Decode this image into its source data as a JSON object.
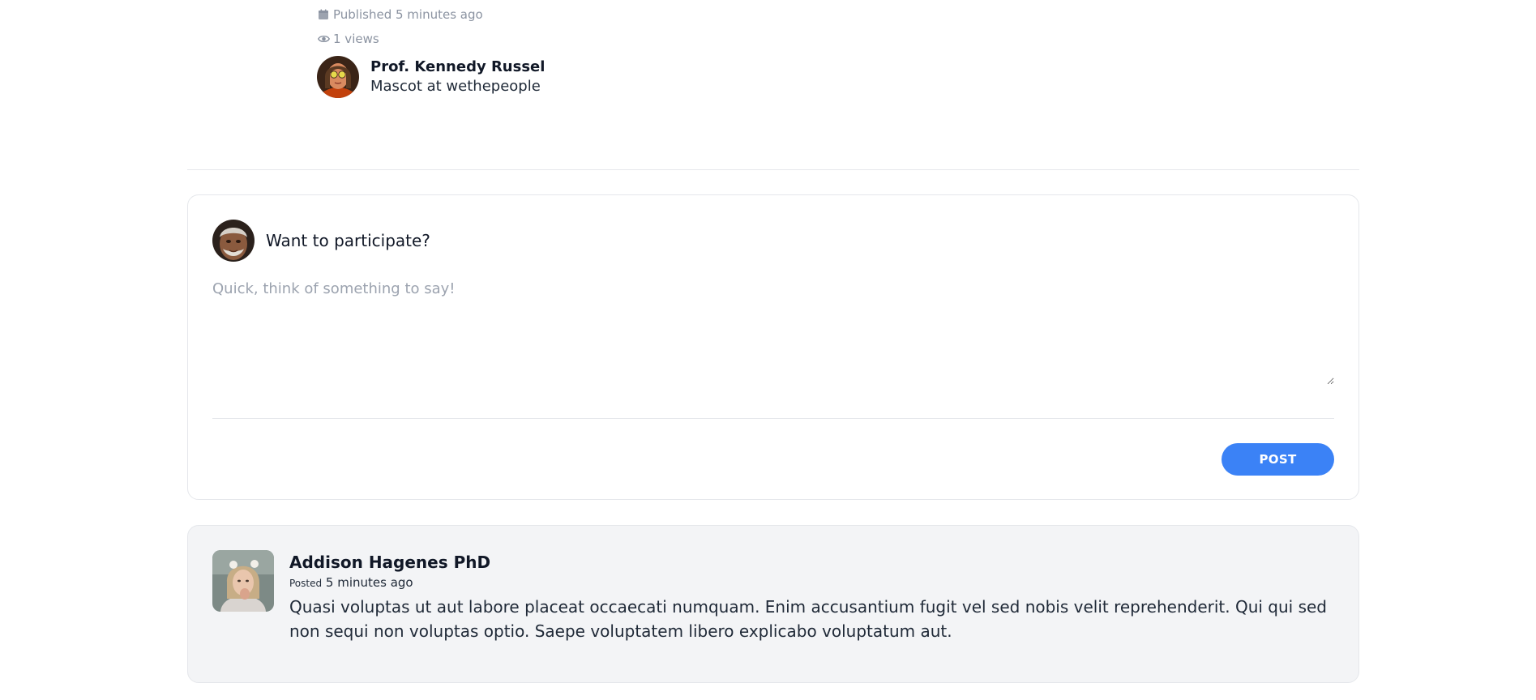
{
  "article_meta": {
    "published_text": "Published 5 minutes ago",
    "views_text": "1 views",
    "author": {
      "name": "Prof. Kennedy Russel",
      "role": "Mascot at wethepeople"
    }
  },
  "comment_form": {
    "title": "Want to participate?",
    "input_value": "",
    "input_placeholder": "Quick, think of something to say!",
    "post_label": "POST"
  },
  "comments": [
    {
      "author": "Addison Hagenes PhD",
      "posted_label": "Posted",
      "posted_time": "5 minutes ago",
      "text": "Quasi voluptas ut aut labore placeat occaecati numquam. Enim accusantium fugit vel sed nobis velit reprehenderit. Qui qui sed non sequi non voluptas optio. Saepe voluptatem libero explicabo voluptatum aut."
    }
  ],
  "colors": {
    "accent": "#3b82f6",
    "meta_text": "#8b93a1",
    "comment_bg": "#f3f4f6",
    "border": "#e5e7eb"
  },
  "icons": {
    "published": "calendar-icon",
    "views": "eye-icon"
  }
}
